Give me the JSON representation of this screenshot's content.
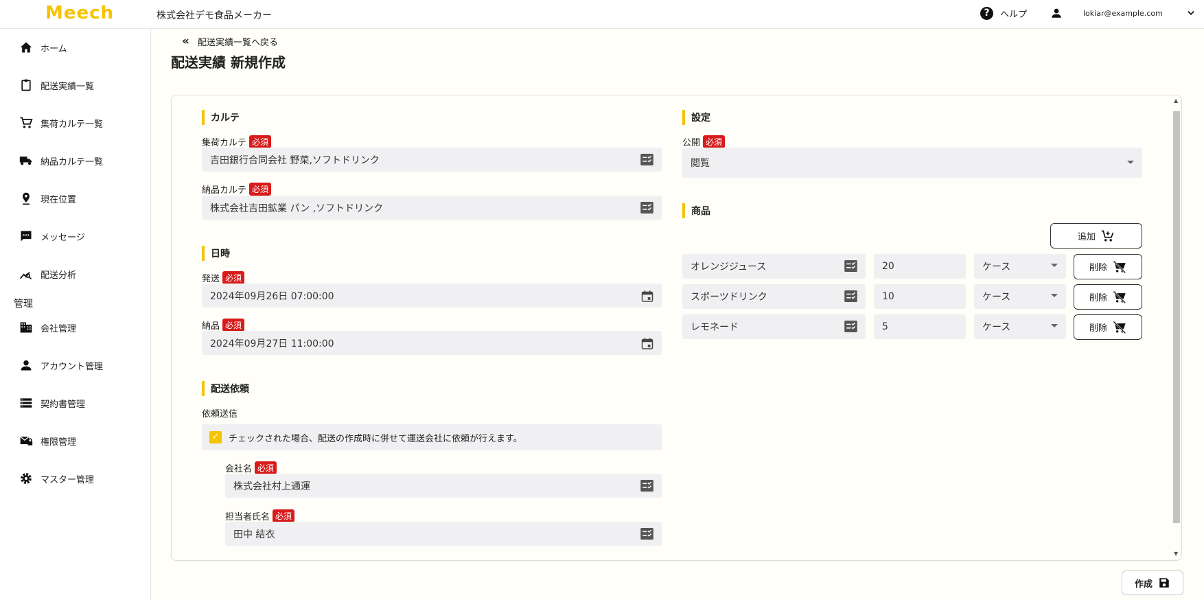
{
  "header": {
    "logo": "Meech",
    "company": "株式会社デモ食品メーカー",
    "help_label": "ヘルプ",
    "user_email": "lokiar@example.com"
  },
  "sidebar": {
    "items": [
      {
        "label": "ホーム",
        "icon": "home-icon"
      },
      {
        "label": "配送実績一覧",
        "icon": "clipboard-icon"
      },
      {
        "label": "集荷カルテ一覧",
        "icon": "cart-icon"
      },
      {
        "label": "納品カルテ一覧",
        "icon": "truck-icon"
      },
      {
        "label": "現在位置",
        "icon": "location-pin-icon"
      },
      {
        "label": "メッセージ",
        "icon": "message-icon"
      },
      {
        "label": "配送分析",
        "icon": "analytics-icon"
      }
    ],
    "section_label": "管理",
    "admin_items": [
      {
        "label": "会社管理",
        "icon": "building-icon"
      },
      {
        "label": "アカウント管理",
        "icon": "person-icon"
      },
      {
        "label": "契約書管理",
        "icon": "list-icon"
      },
      {
        "label": "権限管理",
        "icon": "mail-lock-icon"
      },
      {
        "label": "マスター管理",
        "icon": "gear-icon"
      }
    ]
  },
  "page": {
    "back_link": "配送実績一覧へ戻る",
    "title": "配送実績 新規作成",
    "required_badge": "必須"
  },
  "karte": {
    "heading": "カルテ",
    "pickup_label": "集荷カルテ",
    "pickup_value": "吉田銀行合同会社 野菜,ソフトドリンク",
    "delivery_label": "納品カルテ",
    "delivery_value": "株式会社吉田鉱業 パン ,ソフトドリンク"
  },
  "datetime": {
    "heading": "日時",
    "ship_label": "発送",
    "ship_value": "2024年09月26日 07:00:00",
    "deliver_label": "納品",
    "deliver_value": "2024年09月27日 11:00:00"
  },
  "request": {
    "heading": "配送依頼",
    "send_label": "依頼送信",
    "checkbox_text": "チェックされた場合、配送の作成時に併せて運送会社に依頼が行えます。",
    "checked": true,
    "company_label": "会社名",
    "company_value": "株式会社村上通運",
    "person_label": "担当者氏名",
    "person_value": "田中 結衣"
  },
  "settings": {
    "heading": "設定",
    "public_label": "公開",
    "public_value": "閲覧"
  },
  "products": {
    "heading": "商品",
    "add_label": "追加",
    "delete_label": "削除",
    "rows": [
      {
        "name": "オレンジジュース",
        "qty": "20",
        "unit": "ケース"
      },
      {
        "name": "スポーツドリンク",
        "qty": "10",
        "unit": "ケース"
      },
      {
        "name": "レモネード",
        "qty": "5",
        "unit": "ケース"
      }
    ]
  },
  "footer": {
    "create_label": "作成"
  },
  "colors": {
    "accent": "#f5c400",
    "required": "#d81b1b",
    "field_bg": "#f0f0f2"
  }
}
